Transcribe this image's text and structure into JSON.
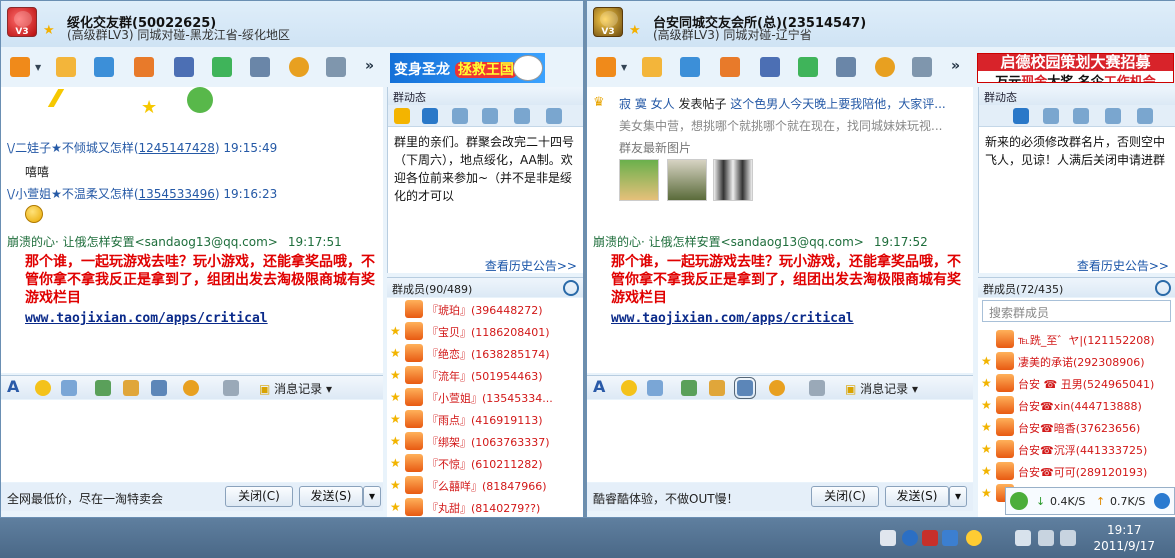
{
  "left": {
    "group_name": "绥化交友群(50022625)",
    "group_sub": "(高级群LV3) 同城对碰-黑龙江省-绥化地区",
    "banner_text_a": "变身圣龙",
    "banner_text_b": "拯救王国",
    "announce_title": "群动态",
    "announce_text": "群里的亲们。群聚会改完二十四号（下周六），地点绥化，AA制。欢迎各位前来参加~（并不是非是绥化的才可以",
    "history_link": "查看历史公告>>",
    "member_header": "群成员(90/489)",
    "messages": [
      {
        "sender": "\\/二娃子★不倾城又怎样(",
        "uid": "1245147428",
        "time": ") 19:15:49",
        "text": "嘻嘻"
      },
      {
        "sender": "\\/小萱姐★不温柔又怎样(",
        "uid": "1354533496",
        "time": ") 19:16:23",
        "text": ""
      },
      {
        "sender": "崩溃的心· 让俄怎样安置<sandaog13@qq.com>",
        "uid": "",
        "time": "19:17:51",
        "text": ""
      }
    ],
    "red_message": "那个谁，一起玩游戏去哇？玩小游戏，还能拿奖品哦，不管你拿不拿我反正是拿到了，组团出发去淘极限商城有奖游戏栏目",
    "link": "www.taojixian.com/apps/critical",
    "members": [
      "『琥珀』(396448272)",
      "『宝贝』(1186208401)",
      "『绝恋』(1638285174)",
      "『流年』(501954463)",
      "『小萱姐』(13545334...",
      "『雨点』(416919113)",
      "『绑架』(1063763337)",
      "『不惊』(610211282)",
      "『么囍咩』(81847966)",
      "『丸甜』(8140279??)"
    ],
    "history_btn": "消息记录",
    "ad_text": "全网最低价，尽在一淘特卖会",
    "close_btn": "关闭(C)",
    "send_btn": "发送(S)"
  },
  "right": {
    "group_name": "台安同城交友会所(总)(23514547)",
    "group_sub": "(高级群LV3) 同城对碰-辽宁省",
    "banner_line1": "启德校园策划大赛招募",
    "banner_line2a": "万元",
    "banner_line2b": "现金",
    "banner_line2c": "大奖   名企",
    "banner_line2d": "工作机会",
    "announce_title": "群动态",
    "announce_text": "新来的必须修改群名片，否则空中飞人，见谅！人满后关闭申请进群",
    "history_link": "查看历史公告>>",
    "member_header": "群成员(72/435)",
    "member_search": "搜索群成员",
    "feed_line1_user": "寂 寞 女人",
    "feed_line1_action": " 发表帖子 ",
    "feed_line1_title": "这个色男人今天晚上要我陪他，大家评...",
    "feed_line2": "美女集中营，想挑哪个就挑哪个就在现在，找同城妹妹玩视...",
    "feed_line3": "群友最新图片",
    "message_sender": "崩溃的心· 让俄怎样安置<sandaog13@qq.com>",
    "message_time": "19:17:52",
    "red_message": "那个谁，一起玩游戏去哇？玩小游戏，还能拿奖品哦，不管你拿不拿我反正是拿到了，组团出发去淘极限商城有奖游戏栏目",
    "link": "www.taojixian.com/apps/critical",
    "members": [
      "℡跣_至゛ヤ|(121152208)",
      "凄美的承诺(292308906)",
      "台安 ☎ 丑男(524965041)",
      "台安☎xin(444713888)",
      "台安☎暗香(37623656)",
      "台安☎沉浮(441333725)",
      "台安☎可可(289120193)",
      "台安☎..."
    ],
    "history_btn": "消息记录",
    "ad_text": "酷睿酷体验，不做OUT慢！",
    "close_btn": "关闭(C)",
    "send_btn": "发送(S)"
  },
  "netmon": {
    "down": "0.4K/S",
    "up": "0.7K/S"
  },
  "clock": {
    "time": "19:17",
    "date": "2011/9/17"
  }
}
